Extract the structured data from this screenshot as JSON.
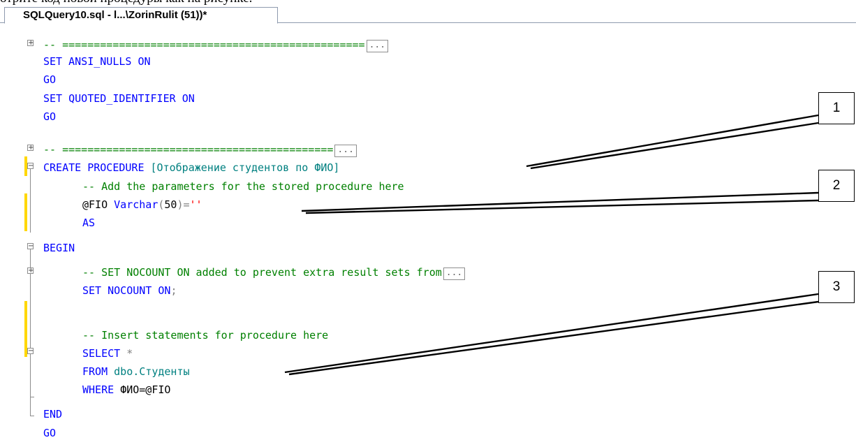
{
  "page_header_text": "отрите код новой процедуры как на рисунке.",
  "tab": {
    "title": "SQLQuery10.sql - l...\\ZorinRulit (51))*"
  },
  "editor": {
    "collapsed_marker": "...",
    "lines": {
      "l1_dashes": "-- ================================================",
      "l2_set": "SET",
      "l2_ansi": "ANSI_NULLS",
      "l2_on": "ON",
      "l3_go": "GO",
      "l4_set": "SET",
      "l4_quoted": "QUOTED_IDENTIFIER",
      "l4_on": "ON",
      "l5_go": "GO",
      "l6_dashes": "-- ===========================================",
      "l7_create": "CREATE PROCEDURE",
      "l7_name": "[Отображение студентов по ФИО]",
      "l8_comment": "-- Add the parameters for the stored procedure here",
      "l9_param": "@FIO",
      "l9_type": "Varchar",
      "l9_open": "(",
      "l9_len": "50",
      "l9_close": ")=",
      "l9_str": "''",
      "l10_as": "AS",
      "l11_begin": "BEGIN",
      "l12_comment": "-- SET NOCOUNT ON added to prevent extra result sets from",
      "l13_set": "SET NOCOUNT ON",
      "l13_semi": ";",
      "l15_comment": "-- Insert statements for procedure here",
      "l16_select": "SELECT",
      "l16_star": "*",
      "l17_from": "FROM",
      "l17_table": "dbo.Студенты",
      "l18_where": "WHERE",
      "l18_cond": "ФИО=@FIO",
      "l19_end": "END",
      "l20_go": "GO"
    }
  },
  "callouts": {
    "c1": "1",
    "c2": "2",
    "c3": "3"
  },
  "colors": {
    "keyword": "#0000ff",
    "comment": "#008000",
    "identifier": "#008080",
    "string": "#ff0000",
    "operator": "#808080",
    "change_marker": "#ffd700"
  }
}
